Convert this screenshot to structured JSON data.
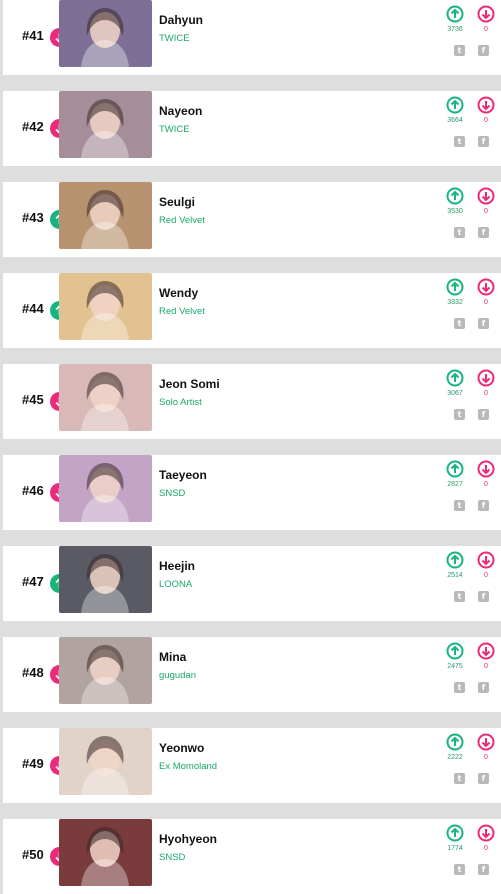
{
  "colors": {
    "trend_down": "#ec2a7b",
    "trend_up": "#17b57c",
    "group_text": "#1ba86a",
    "upvote": "#17b57c",
    "downvote": "#ec2a7b",
    "share_icon": "#b9b9b9"
  },
  "rankings": [
    {
      "rank": "#41",
      "trend": "down",
      "name": "Dahyun",
      "group": "TWICE",
      "upvotes": "3736",
      "downvotes": "0",
      "photo_tint": "#7d6f95"
    },
    {
      "rank": "#42",
      "trend": "down",
      "name": "Nayeon",
      "group": "TWICE",
      "upvotes": "3664",
      "downvotes": "0",
      "photo_tint": "#a58e99"
    },
    {
      "rank": "#43",
      "trend": "up",
      "name": "Seulgi",
      "group": "Red Velvet",
      "upvotes": "3530",
      "downvotes": "0",
      "photo_tint": "#b7926f"
    },
    {
      "rank": "#44",
      "trend": "up",
      "name": "Wendy",
      "group": "Red Velvet",
      "upvotes": "3332",
      "downvotes": "0",
      "photo_tint": "#e3c291"
    },
    {
      "rank": "#45",
      "trend": "down",
      "name": "Jeon Somi",
      "group": "Solo Artist",
      "upvotes": "3067",
      "downvotes": "0",
      "photo_tint": "#d9b8b8"
    },
    {
      "rank": "#46",
      "trend": "down",
      "name": "Taeyeon",
      "group": "SNSD",
      "upvotes": "2827",
      "downvotes": "0",
      "photo_tint": "#c4a4c6"
    },
    {
      "rank": "#47",
      "trend": "up",
      "name": "Heejin",
      "group": "LOONA",
      "upvotes": "2514",
      "downvotes": "0",
      "photo_tint": "#5a5a64"
    },
    {
      "rank": "#48",
      "trend": "down",
      "name": "Mina",
      "group": "gugudan",
      "upvotes": "2475",
      "downvotes": "0",
      "photo_tint": "#b1a3a0"
    },
    {
      "rank": "#49",
      "trend": "down",
      "name": "Yeonwo",
      "group": "Ex Momoland",
      "upvotes": "2222",
      "downvotes": "0",
      "photo_tint": "#e2d3c8"
    },
    {
      "rank": "#50",
      "trend": "down",
      "name": "Hyohyeon",
      "group": "SNSD",
      "upvotes": "1774",
      "downvotes": "0",
      "photo_tint": "#7a3b3c"
    }
  ],
  "icons": {
    "upvote": "arrow-up-circle-icon",
    "downvote": "arrow-down-circle-icon",
    "twitter": "twitter-icon",
    "facebook": "facebook-icon"
  }
}
